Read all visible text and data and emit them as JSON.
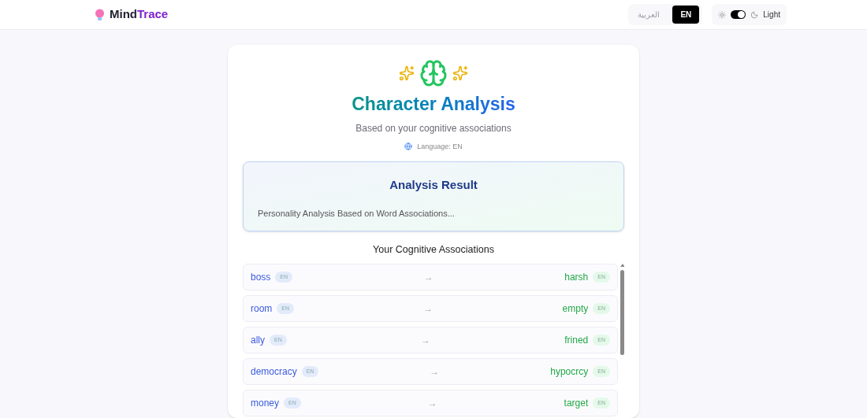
{
  "brand": {
    "first": "Mind",
    "second": "Trace"
  },
  "languages": [
    {
      "label": "العربية",
      "selected": false
    },
    {
      "label": "EN",
      "selected": true
    }
  ],
  "theme_toggle": {
    "on": true,
    "label": "Light"
  },
  "hero": {
    "title": "Character Analysis",
    "subtitle": "Based on your cognitive associations",
    "language": "Language: EN"
  },
  "result": {
    "title": "Analysis Result",
    "text": "Personality Analysis Based on Word Associations..."
  },
  "associations": {
    "title": "Your Cognitive Associations",
    "rows": [
      {
        "word": "boss",
        "word_lang": "EN",
        "arrow": "→",
        "answer": "harsh",
        "answer_lang": "EN"
      },
      {
        "word": "room",
        "word_lang": "EN",
        "arrow": "→",
        "answer": "empty",
        "answer_lang": "EN"
      },
      {
        "word": "ally",
        "word_lang": "EN",
        "arrow": "→",
        "answer": "frined",
        "answer_lang": "EN"
      },
      {
        "word": "democracy",
        "word_lang": "EN",
        "arrow": "→",
        "answer": "hypocrcy",
        "answer_lang": "EN"
      },
      {
        "word": "money",
        "word_lang": "EN",
        "arrow": "→",
        "answer": "target",
        "answer_lang": "EN"
      }
    ]
  }
}
